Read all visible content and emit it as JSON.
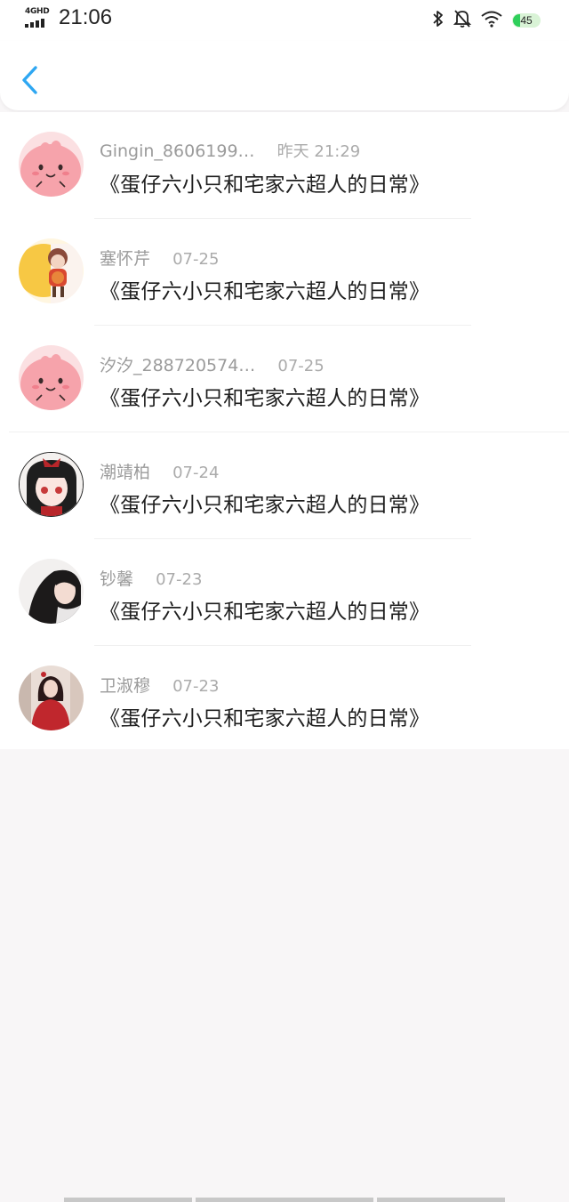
{
  "status_bar": {
    "network": "4GHD",
    "time": "21:06",
    "battery": "45",
    "icons": [
      "signal-icon",
      "bluetooth-icon",
      "bell-off-icon",
      "wifi-icon",
      "battery-icon"
    ]
  },
  "nav": {
    "back_icon": "chevron-left-icon",
    "accent": "#2ea7f2"
  },
  "list": [
    {
      "username": "Gingin_8606199…",
      "date": "昨天 21:29",
      "title": "《蛋仔六小只和宅家六超人的日常》",
      "avatar": "pink-cartoon-avatar"
    },
    {
      "username": "塞怀芹",
      "date": "07-25",
      "title": "《蛋仔六小只和宅家六超人的日常》",
      "avatar": "doll-moon-avatar"
    },
    {
      "username": "汐汐_288720574…",
      "date": "07-25",
      "title": "《蛋仔六小只和宅家六超人的日常》",
      "avatar": "pink-cartoon-avatar"
    },
    {
      "username": "潮靖柏",
      "date": "07-24",
      "title": "《蛋仔六小只和宅家六超人的日常》",
      "avatar": "anime-girl-avatar"
    },
    {
      "username": "钞馨",
      "date": "07-23",
      "title": "《蛋仔六小只和宅家六超人的日常》",
      "avatar": "woman-portrait-avatar"
    },
    {
      "username": "卫淑穆",
      "date": "07-23",
      "title": "《蛋仔六小只和宅家六超人的日常》",
      "avatar": "woman-red-dress-avatar"
    }
  ]
}
